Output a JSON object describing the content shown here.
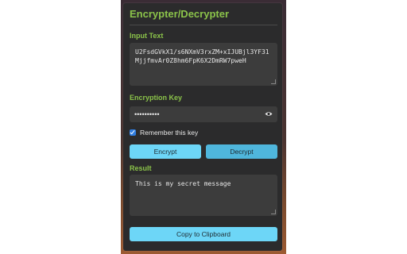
{
  "app": {
    "title": "Encrypter/Decrypter"
  },
  "input": {
    "label": "Input Text",
    "value": "U2FsdGVkX1/s6NXmV3rxZM+xIJUBjl3YF31MjjfmvAr0Z8hm6FpK6X2DmRW7pweH"
  },
  "key": {
    "label": "Encryption Key",
    "masked_value": "••••••••••",
    "visibility_icon": "eye-icon"
  },
  "remember": {
    "label": "Remember this key",
    "checked": true
  },
  "buttons": {
    "encrypt": "Encrypt",
    "decrypt": "Decrypt",
    "copy": "Copy to Clipboard"
  },
  "result": {
    "label": "Result",
    "value": "This is my secret message"
  },
  "colors": {
    "accent_green": "#8bc34a",
    "button_light": "#6dd6f7",
    "button_dark": "#4fb6dc",
    "panel_bg": "#2b2b2c"
  }
}
